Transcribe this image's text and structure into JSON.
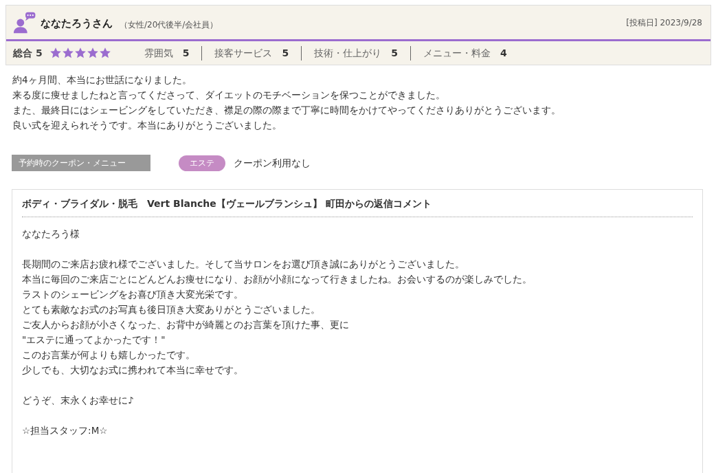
{
  "reviewer": {
    "name": "ななたろうさん",
    "profile": "（女性/20代後半/会社員）",
    "posted": "[投稿日] 2023/9/28"
  },
  "overall": {
    "label": "総合",
    "score": "5",
    "stars": 5
  },
  "ratings": [
    {
      "label": "雰囲気",
      "score": "5"
    },
    {
      "label": "接客サービス",
      "score": "5"
    },
    {
      "label": "技術・仕上がり",
      "score": "5"
    },
    {
      "label": "メニュー・料金",
      "score": "4"
    }
  ],
  "review_lines": [
    "約4ヶ月間、本当にお世話になりました。",
    "来る度に痩せましたねと言ってくださって、ダイエットのモチベーションを保つことができました。",
    "また、最終日にはシェービングをしていただき、襟足の際の際まで丁寧に時間をかけてやってくださりありがとうございます。",
    "良い式を迎えられそうです。本当にありがとうございました。"
  ],
  "coupon": {
    "label": "予約時のクーポン・メニュー",
    "tag": "エステ",
    "value": "クーポン利用なし"
  },
  "reply": {
    "title": "ボディ・ブライダル・脱毛　Vert Blanche【ヴェールブランシュ】 町田からの返信コメント",
    "paragraphs": [
      [
        "ななたろう様"
      ],
      [
        "長期間のご来店お疲れ様でございました。そして当サロンをお選び頂き誠にありがとうございました。",
        "本当に毎回のご来店ごとにどんどんお痩せになり、お顔が小顔になって行きましたね。お会いするのが楽しみでした。",
        "ラストのシェービングをお喜び頂き大変光栄です。",
        "とても素敵なお式のお写真も後日頂き大変ありがとうございました。",
        "ご友人からお顔が小さくなった、お背中が綺麗とのお言葉を頂けた事、更に",
        "\"エステに通ってよかったです！\"",
        "このお言葉が何よりも嬉しかったです。",
        "少しでも、大切なお式に携われて本当に幸せです。"
      ],
      [
        "どうぞ、末永くお幸せに♪"
      ],
      [
        "☆担当スタッフ:M☆"
      ]
    ]
  }
}
